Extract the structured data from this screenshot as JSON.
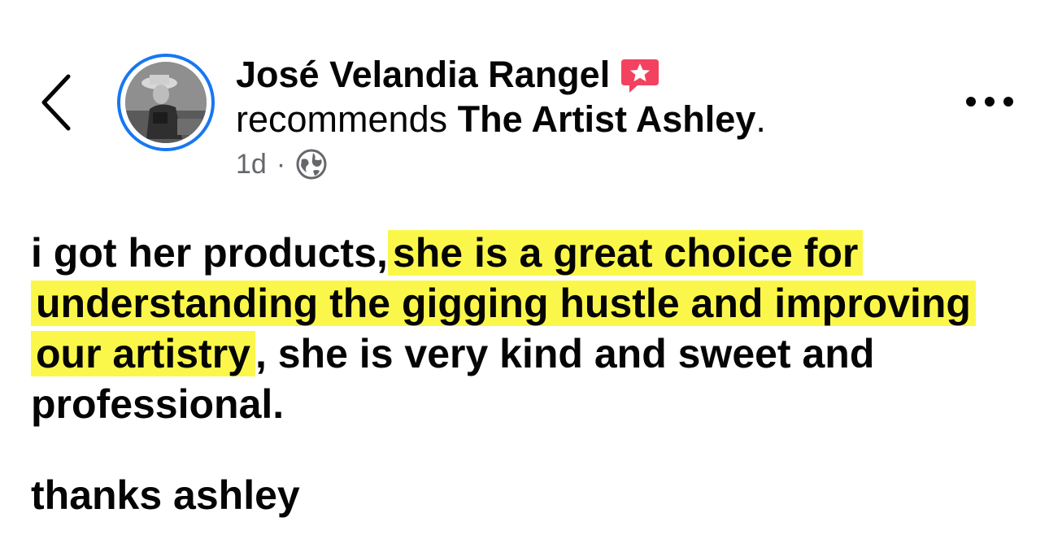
{
  "header": {
    "author_name": "José Velandia Rangel",
    "recommend_verb": "recommends",
    "page_name": "The Artist Ashley",
    "period": ".",
    "time": "1d",
    "separator": "·",
    "privacy_icon": "globe-icon",
    "badge_icon": "recommend-star-icon",
    "badge_color": "#f3425f",
    "avatar_ring_color": "#1877f2"
  },
  "post": {
    "text_before": "i got her products,",
    "highlighted": "she is a great choice for understanding the gigging hustle and improving our artistry",
    "text_after": ",  she is very kind and sweet and professional.",
    "closing": "thanks ashley",
    "highlight_color": "#fbf74a"
  },
  "controls": {
    "back_icon": "chevron-left-icon",
    "more_icon": "more-options-icon"
  }
}
